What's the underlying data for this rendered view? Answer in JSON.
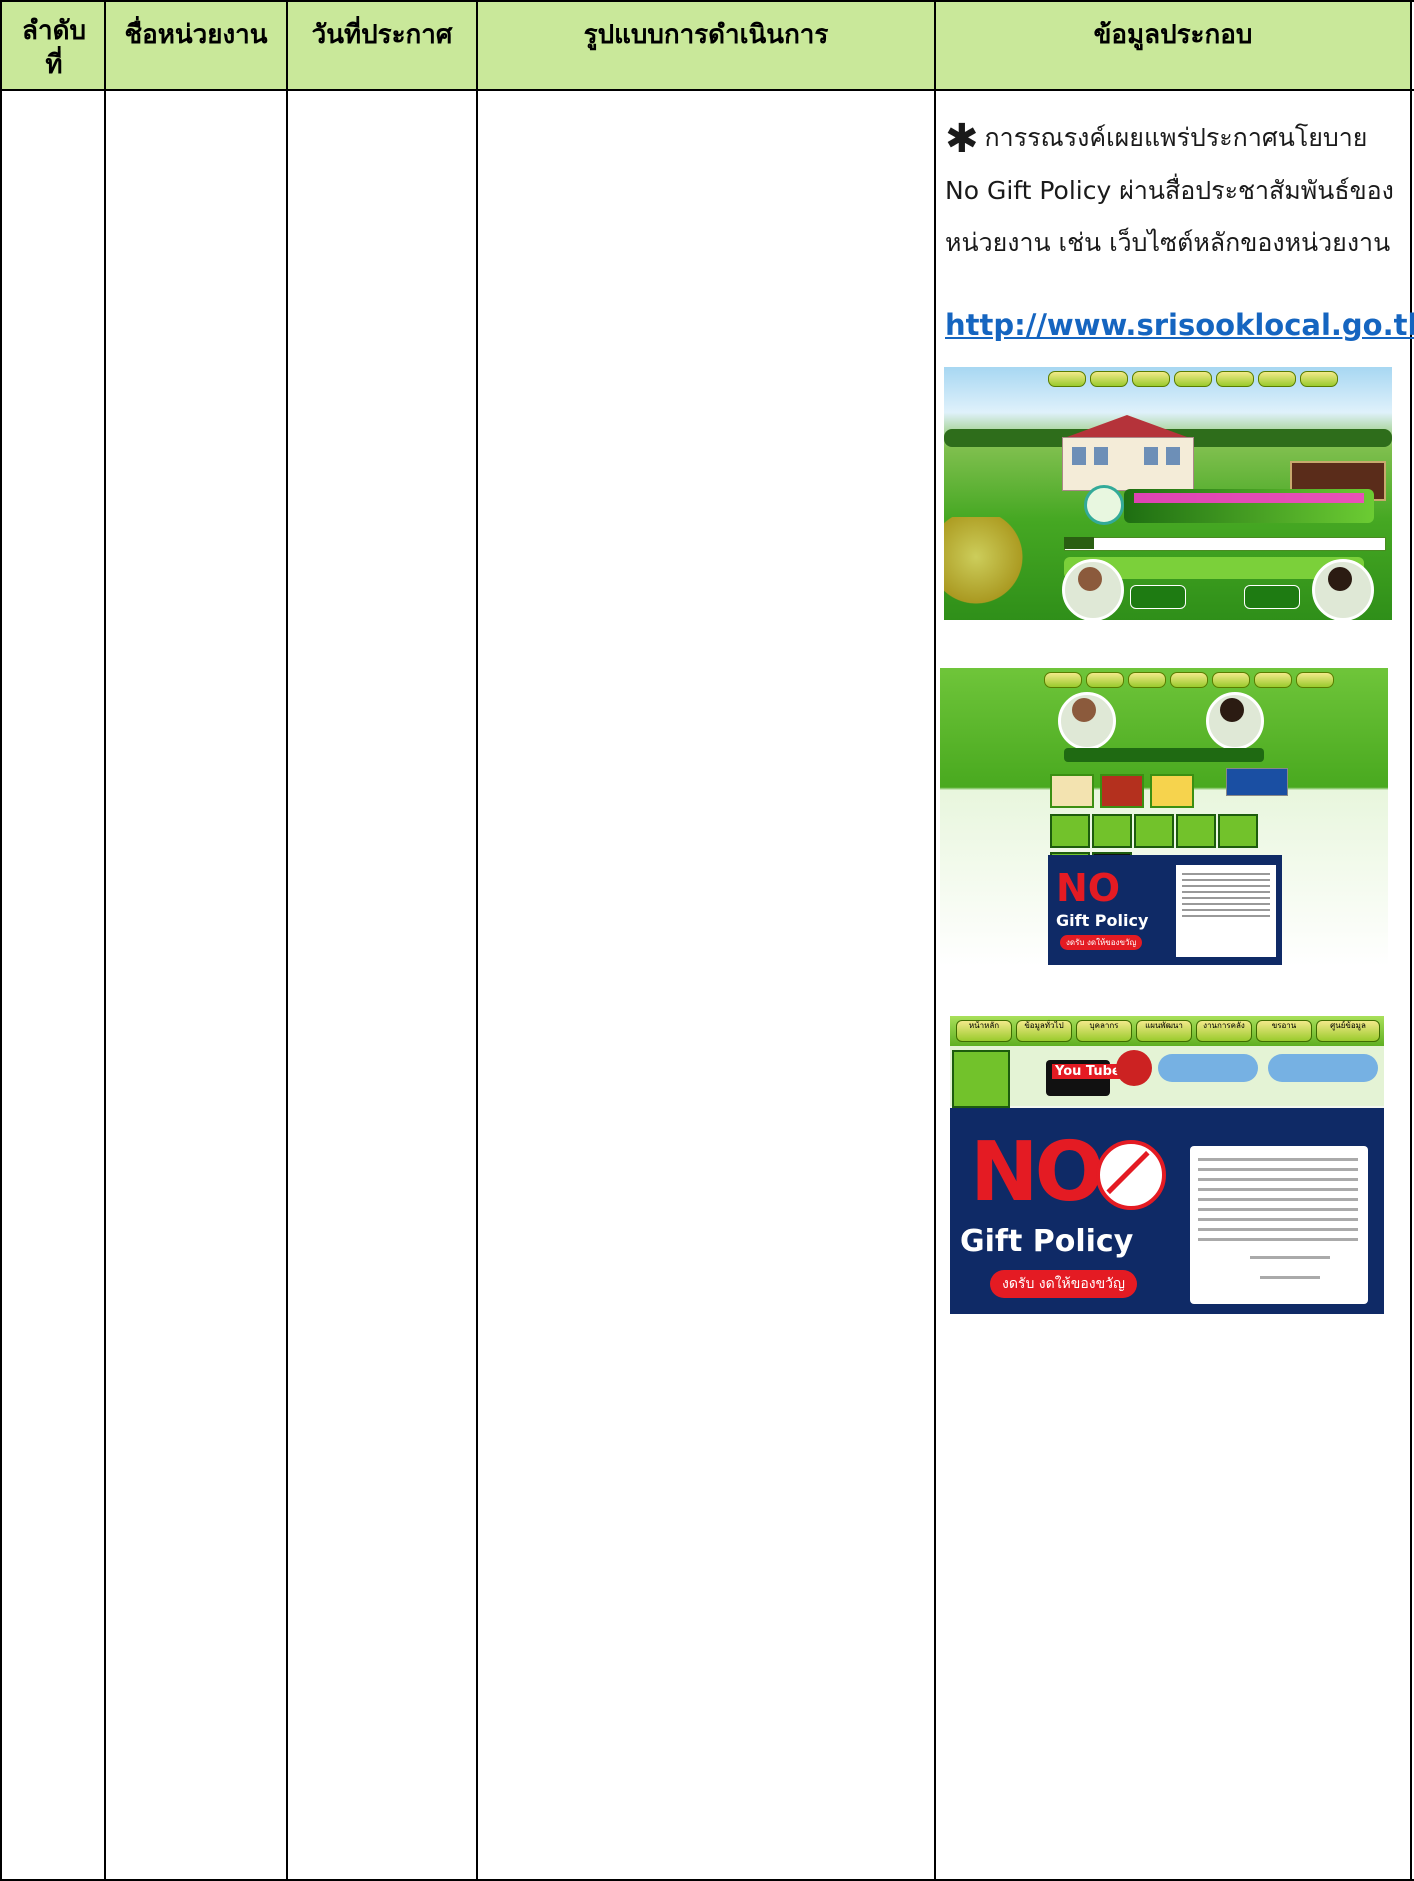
{
  "table": {
    "headers": {
      "order": "ลำดับ\nที่",
      "agency": "ชื่อหน่วยงาน",
      "date": "วันที่ประกาศ",
      "method": "รูปแบบการดำเนินการ",
      "info": "ข้อมูลประกอบ"
    }
  },
  "info": {
    "star": "✱",
    "text": "การรณรงค์เผยแพร่ประกาศนโยบาย No Gift Policy ผ่านสื่อประชาสัมพันธ์ของหน่วยงาน เช่น เว็บไซต์หลักของหน่วยงาน",
    "url": "http://www.srisooklocal.go.th"
  },
  "screens": {
    "policy_big_no": "NO",
    "policy_gift": "Gift Policy",
    "policy_tag": "งดรับ งดให้ของขวัญ",
    "youtube": "You Tube",
    "nav": [
      "หน้าหลัก",
      "ข้อมูลทั่วไป",
      "บุคลากร",
      "แผนพัฒนา",
      "งานการคลัง",
      "ขรอาน",
      "ศูนย์ข้อมูล"
    ]
  },
  "colors": {
    "header_bg": "#c9e89a",
    "link": "#1565c0",
    "grass": "#3fae1f",
    "policy_bg": "#0f2a66",
    "no_red": "#e41b23"
  }
}
